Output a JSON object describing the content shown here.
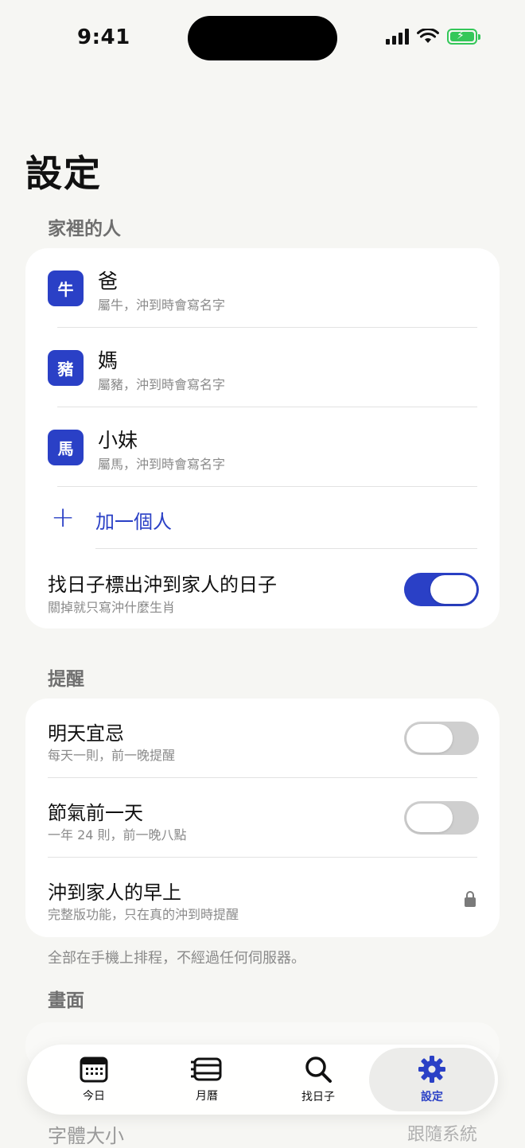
{
  "status": {
    "time": "9:41"
  },
  "page": {
    "title": "設定"
  },
  "family": {
    "section_title": "家裡的人",
    "people": [
      {
        "badge": "牛",
        "name": "爸",
        "sub": "屬牛，沖到時會寫名字"
      },
      {
        "badge": "豬",
        "name": "媽",
        "sub": "屬豬，沖到時會寫名字"
      },
      {
        "badge": "馬",
        "name": "小妹",
        "sub": "屬馬，沖到時會寫名字"
      }
    ],
    "add_label": "加一個人",
    "mark_toggle": {
      "title": "找日子標出沖到家人的日子",
      "sub": "關掉就只寫沖什麼生肖",
      "on": true
    }
  },
  "reminders": {
    "section_title": "提醒",
    "items": [
      {
        "title": "明天宜忌",
        "sub": "每天一則，前一晚提醒",
        "on": false
      },
      {
        "title": "節氣前一天",
        "sub": "一年 24 則，前一晚八點",
        "on": false
      },
      {
        "title": "沖到家人的早上",
        "sub": "完整版功能，只在真的沖到時提醒",
        "locked": true
      }
    ],
    "footnote": "全部在手機上排程，不經過任何伺服器。"
  },
  "display": {
    "section_title": "畫面",
    "font_size_label": "字體大小",
    "font_size_value": "跟隨系統"
  },
  "tabs": [
    {
      "label": "今日",
      "icon": "calendar-day-icon"
    },
    {
      "label": "月曆",
      "icon": "month-calendar-icon"
    },
    {
      "label": "找日子",
      "icon": "search-icon"
    },
    {
      "label": "設定",
      "icon": "gear-icon",
      "active": true
    }
  ],
  "colors": {
    "accent": "#2a40c6",
    "background": "#f6f6f3",
    "battery": "#34c759"
  }
}
